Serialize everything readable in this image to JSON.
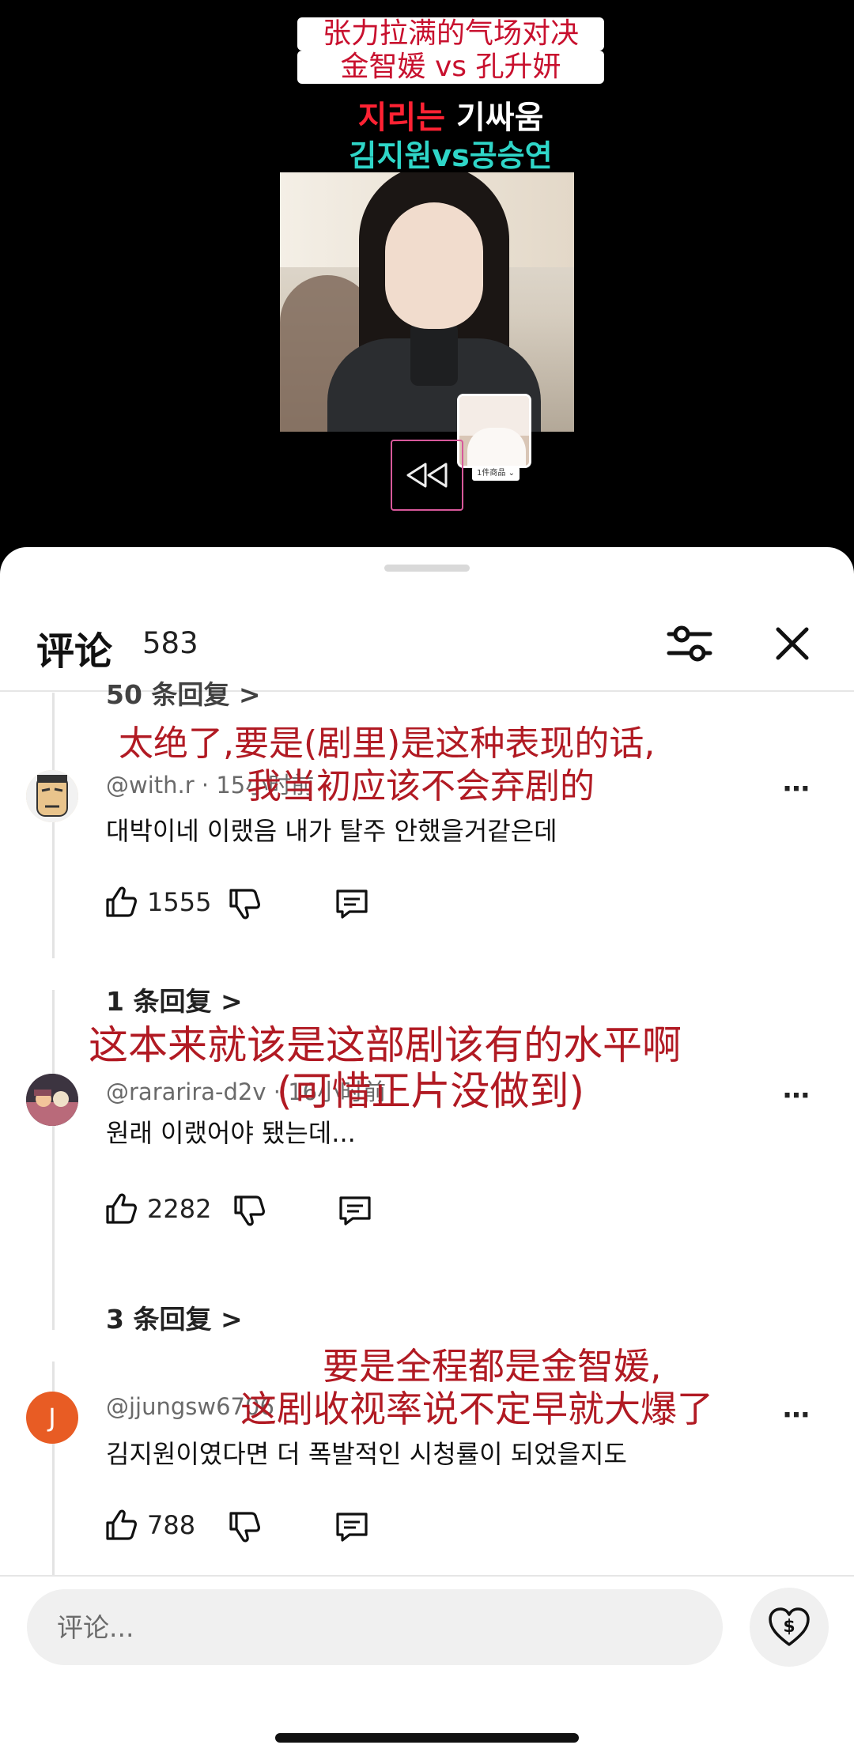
{
  "video": {
    "caption_cn_line1": "张力拉满的气场对决",
    "caption_cn_line2": "金智媛 vs 孔升妍",
    "caption_kr_red": "지리는",
    "caption_kr_white": "기싸움",
    "caption_kr_line2": "김지원vs공승연",
    "product_label": "1件商品 ⌄"
  },
  "sheet": {
    "title": "评论",
    "count": "583"
  },
  "partial_replies_text": "50 条回复 >",
  "comments": [
    {
      "handle": "@with.r · 15小时前",
      "text": "대박이네 이랬음 내가 탈주 안했을거같은데",
      "likes": "1555",
      "overlay_line1": "太绝了,要是(剧里)是这种表现的话,",
      "overlay_line2": "我当初应该不会弃剧的",
      "replies": "1 条回复 >"
    },
    {
      "handle": "@rararira-d2v · 16小时前",
      "text": "원래 이랬어야 됐는데...",
      "likes": "2282",
      "overlay_line1": "这本来就该是这部剧该有的水平啊",
      "overlay_line2": "(可惜正片没做到)",
      "replies": "3 条回复 >"
    },
    {
      "handle": "@jjungsw6706",
      "text": "김지원이였다면 더 폭발적인 시청률이 되었을지도",
      "likes": "788",
      "avatar_letter": "J",
      "overlay_line1": "要是全程都是金智媛,",
      "overlay_line2": "这剧收视率说不定早就大爆了"
    }
  ],
  "input": {
    "placeholder": "评论..."
  },
  "colors": {
    "overlay_red": "#b11a23",
    "avatar_orange": "#e85c24"
  }
}
